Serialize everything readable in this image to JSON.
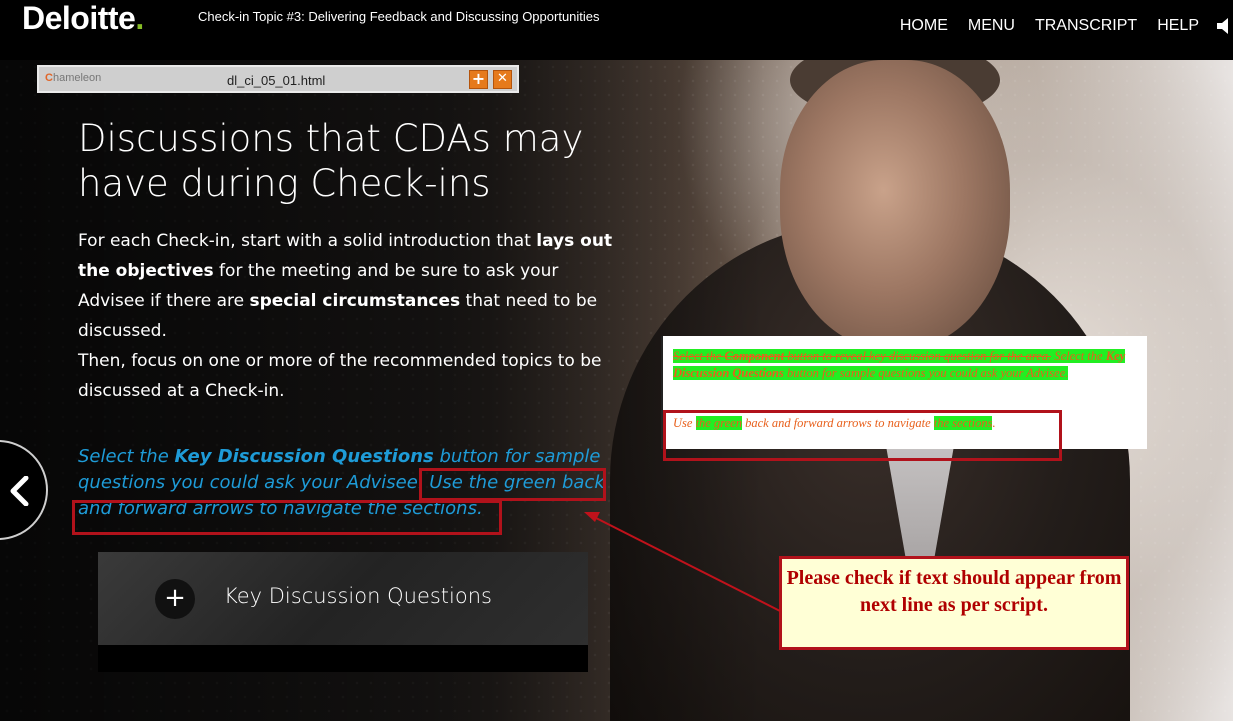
{
  "header": {
    "logo_text": "Deloitte",
    "logo_dot": ".",
    "course_title": "Check-in Topic #3: Delivering Feedback and Discussing Opportunities",
    "nav": [
      "HOME",
      "MENU",
      "TRANSCRIPT",
      "HELP"
    ],
    "speaker_icon": "speaker-icon"
  },
  "chameleon": {
    "logo": "hameleon",
    "logo_initial": "C",
    "filename": "dl_ci_05_01.html",
    "expand_icon": "+",
    "close_icon": "✕"
  },
  "content": {
    "headline": "Discussions that CDAs may have during Check-ins",
    "para1": {
      "t1": "For each Check-in, start with a solid introduction that ",
      "b1": "lays out the objectives",
      "t2": " for the meeting and be sure to ask your Advisee if there are ",
      "b2": "special circumstances",
      "t3": " that need to be discussed."
    },
    "para2": "Then, focus on one or more of the recommended topics to be discussed at a Check-in.",
    "instruction": {
      "t1": "Select the ",
      "b1": "Key Discussion Questions",
      "t2": " button for sample questions you could ask your Advisee. ",
      "t3": "Use the green back and forward arrows to navigate the sections."
    },
    "kdq_button": "Key Discussion Questions",
    "kdq_plus": "+"
  },
  "script_excerpt": {
    "line1": {
      "a": "Select the ",
      "b": "Component",
      "c": " button to reveal key discussion question for the area.",
      "d": " Select the ",
      "e": "Key Discussion Questions",
      "f": " button for sample questions you could ask your Advisee."
    },
    "line2": {
      "a": "Use ",
      "b": "the green",
      "c": " back and forward arrows to navigate ",
      "d": "the sections",
      "e": "."
    }
  },
  "review_comment": "Please check if text should appear from next line as per script.",
  "colors": {
    "accent_green": "#86bc25",
    "instruction_blue": "#1e9bd7",
    "review_red": "#b1121b",
    "script_orange": "#e8601c",
    "highlight_green": "#22ee22",
    "comment_bg": "#ffffd6"
  }
}
